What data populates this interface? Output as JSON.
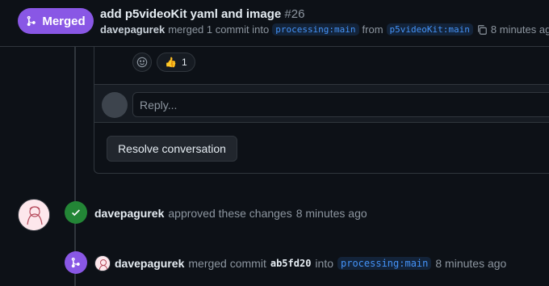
{
  "header": {
    "state_label": "Merged",
    "title": "add p5videoKit yaml and image",
    "number": "#26",
    "meta": {
      "author": "davepagurek",
      "text_merged": "merged 1 commit into",
      "base_branch": "processing:main",
      "text_from": "from",
      "head_branch": "p5videoKit:main",
      "time": "8 minutes ago"
    }
  },
  "reactions": {
    "emoji": "👍",
    "count": "1"
  },
  "reply": {
    "placeholder": "Reply..."
  },
  "resolve_button": "Resolve conversation",
  "timeline": {
    "approve": {
      "author": "davepagurek",
      "text": "approved these changes",
      "time": "8 minutes ago"
    },
    "merge": {
      "author": "davepagurek",
      "text_a": "merged commit",
      "sha": "ab5fd20",
      "text_b": "into",
      "branch": "processing:main",
      "time": "8 minutes ago"
    }
  },
  "colors": {
    "merged_purple": "#8957e5",
    "approve_green": "#238636",
    "link_blue": "#4493f8",
    "background": "#0d1117"
  },
  "icons": [
    "git-merge-icon",
    "copy-icon",
    "smiley-icon",
    "check-icon"
  ]
}
